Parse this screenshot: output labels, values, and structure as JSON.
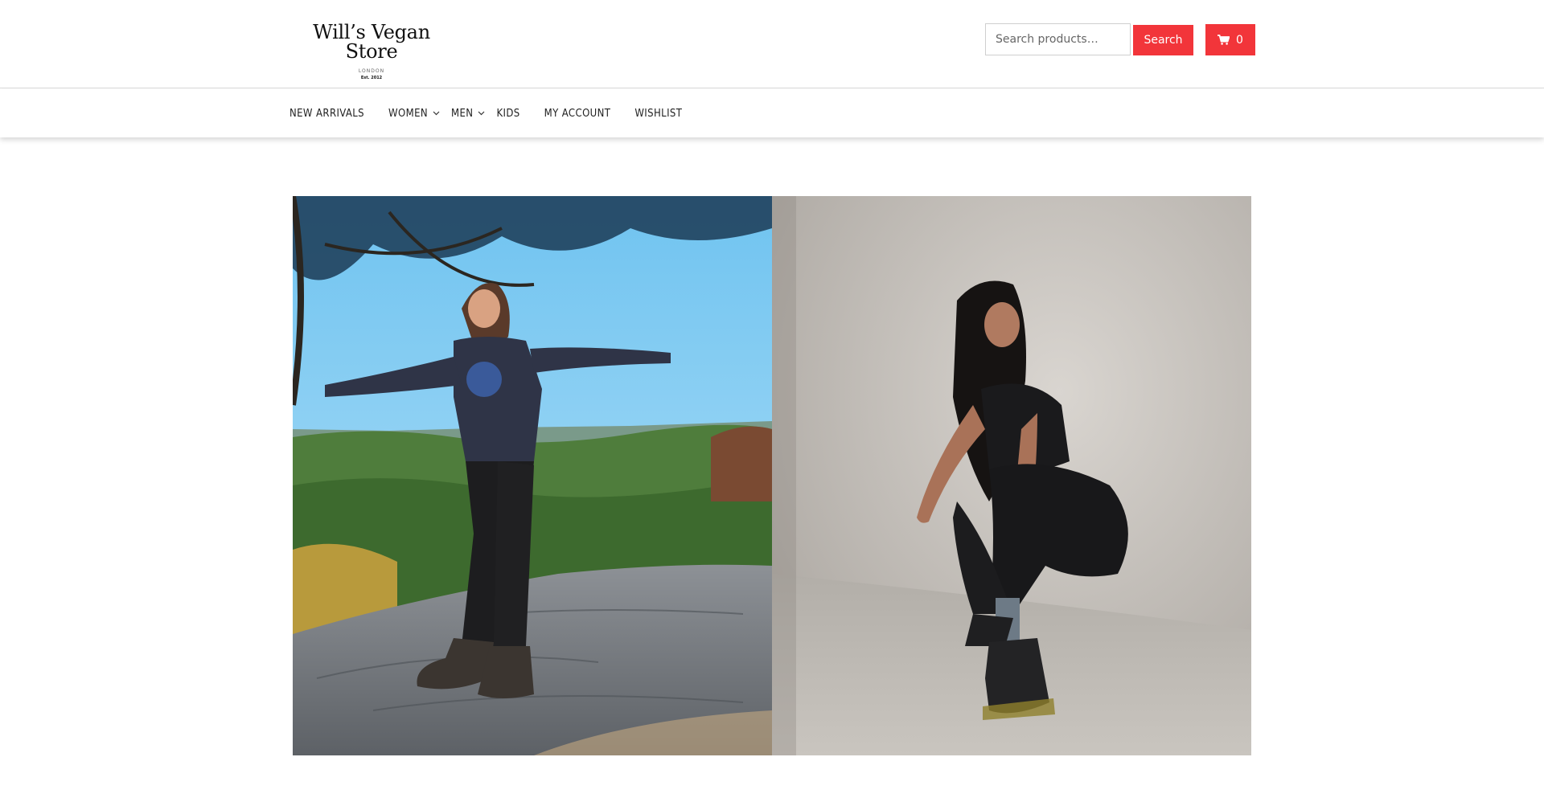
{
  "header": {
    "logo": {
      "title": "Will’s Vegan Store",
      "subtitle": "LONDON",
      "est": "Est. 2012"
    },
    "search": {
      "placeholder": "Search products…",
      "value": "",
      "button_label": "Search"
    },
    "cart": {
      "icon": "cart-icon",
      "count": "0"
    },
    "accent_color": "#f2353a"
  },
  "nav": {
    "items": [
      {
        "label": "NEW ARRIVALS",
        "has_submenu": false
      },
      {
        "label": "WOMEN",
        "has_submenu": true
      },
      {
        "label": "MEN",
        "has_submenu": true
      },
      {
        "label": "KIDS",
        "has_submenu": false
      },
      {
        "label": "MY ACCOUNT",
        "has_submenu": false
      },
      {
        "label": "WISHLIST",
        "has_submenu": false
      }
    ]
  },
  "hero": {
    "images": [
      {
        "name": "woman-hiking-on-cliff-photo"
      },
      {
        "name": "woman-crouching-lacing-boot-photo"
      }
    ]
  }
}
